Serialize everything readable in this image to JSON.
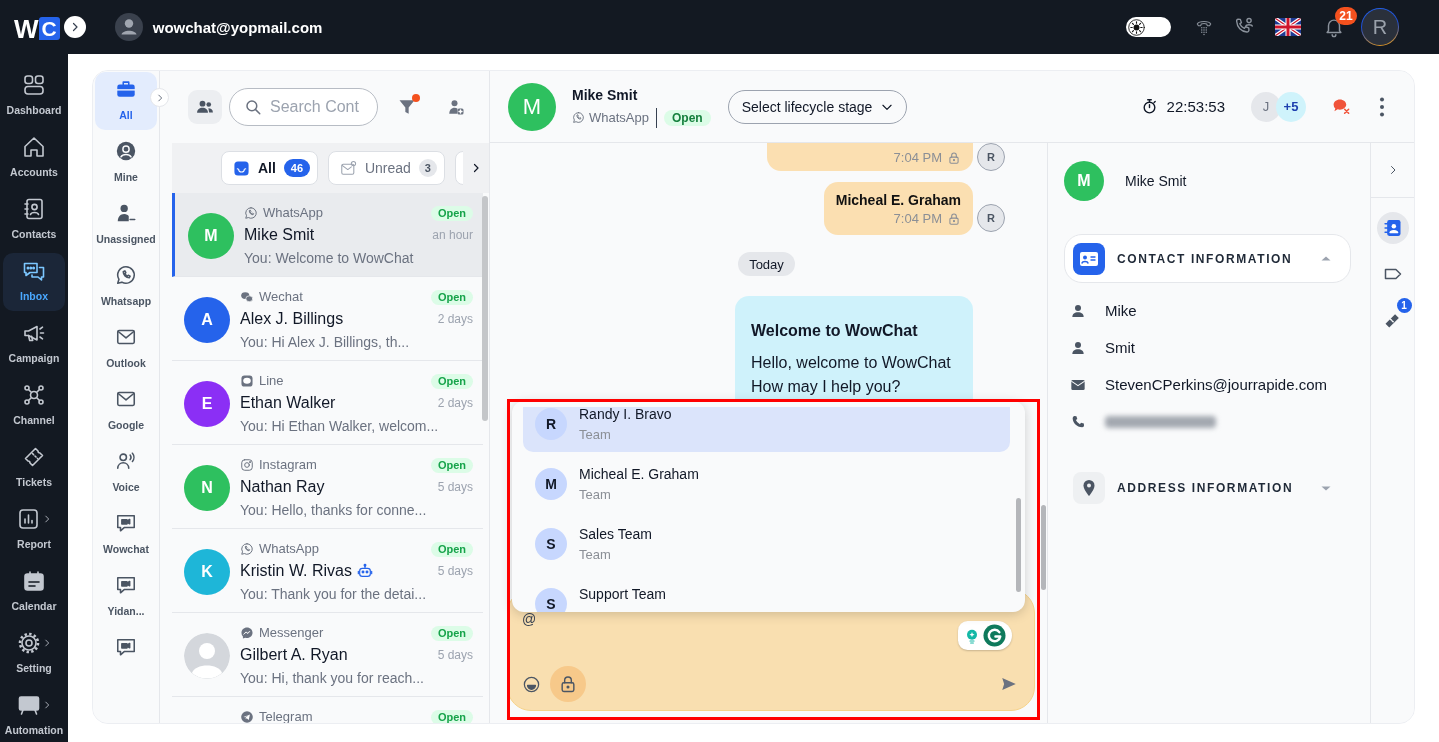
{
  "topbar": {
    "logo": {
      "first": "W",
      "second": "C"
    },
    "user_email": "wowchat@yopmail.com",
    "theme_toggle": {
      "on": false
    },
    "notification_count": "21",
    "profile_initial": "R"
  },
  "nav": {
    "items": [
      {
        "label": "Dashboard",
        "kind": "dashboard",
        "selected": false,
        "submenu": false
      },
      {
        "label": "Accounts",
        "kind": "accounts",
        "selected": false,
        "submenu": false
      },
      {
        "label": "Contacts",
        "kind": "contacts",
        "selected": false,
        "submenu": false
      },
      {
        "label": "Inbox",
        "kind": "inbox",
        "selected": true,
        "submenu": false
      },
      {
        "label": "Campaign",
        "kind": "campaign",
        "selected": false,
        "submenu": false
      },
      {
        "label": "Channel",
        "kind": "channel",
        "selected": false,
        "submenu": false
      },
      {
        "label": "Tickets",
        "kind": "tickets",
        "selected": false,
        "submenu": false
      },
      {
        "label": "Report",
        "kind": "report",
        "selected": false,
        "submenu": true
      },
      {
        "label": "Calendar",
        "kind": "calendar",
        "selected": false,
        "submenu": false
      },
      {
        "label": "Setting",
        "kind": "setting",
        "selected": false,
        "submenu": true
      },
      {
        "label": "Automation",
        "kind": "automation",
        "selected": false,
        "submenu": true
      }
    ]
  },
  "inbox_filters": {
    "items": [
      {
        "label": "All",
        "kind": "all",
        "selected": true
      },
      {
        "label": "Mine",
        "kind": "mine",
        "selected": false
      },
      {
        "label": "Unassigned",
        "kind": "unassigned",
        "selected": false
      },
      {
        "label": "Whatsapp",
        "kind": "whatsapp",
        "selected": false
      },
      {
        "label": "Outlook",
        "kind": "mail",
        "selected": false
      },
      {
        "label": "Google",
        "kind": "mail",
        "selected": false
      },
      {
        "label": "Voice",
        "kind": "voice",
        "selected": false
      },
      {
        "label": "Wowchat",
        "kind": "video",
        "selected": false
      },
      {
        "label": "Yidan...",
        "kind": "video",
        "selected": false
      },
      {
        "kind": "video",
        "selected": false
      }
    ]
  },
  "conversation_list": {
    "search": {
      "placeholder": "Search Cont"
    },
    "filter_active": true,
    "tabs": [
      {
        "label": "All",
        "count": "46",
        "kind": "all",
        "selected": true
      },
      {
        "label": "Unread",
        "count": "3",
        "kind": "unread",
        "selected": false
      }
    ],
    "conversations": [
      {
        "kind": "whatsapp",
        "channel": "WhatsApp",
        "name": "Mike Smit",
        "preview": "You: Welcome to WowChat",
        "status": "Open",
        "time": "an hour",
        "avatar": {
          "kind": "letter",
          "text": "M",
          "color": "#2ec05f"
        },
        "bot": false,
        "selected": true
      },
      {
        "kind": "wechat",
        "channel": "Wechat",
        "name": "Alex J. Billings",
        "preview": "You: Hi Alex J. Billings, th...",
        "status": "Open",
        "time": "2 days",
        "avatar": {
          "kind": "letter",
          "text": "A",
          "color": "#2563eb"
        },
        "bot": false,
        "selected": false
      },
      {
        "kind": "line",
        "channel": "Line",
        "name": "Ethan Walker",
        "preview": "You: Hi Ethan Walker, welcom...",
        "status": "Open",
        "time": "2 days",
        "avatar": {
          "kind": "letter",
          "text": "E",
          "color": "#8b2ff5"
        },
        "bot": false,
        "selected": false
      },
      {
        "kind": "instagram",
        "channel": "Instagram",
        "name": "Nathan Ray",
        "preview": "You: Hello, thanks for conne...",
        "status": "Open",
        "time": "5 days",
        "avatar": {
          "kind": "letter",
          "text": "N",
          "color": "#2ec05f"
        },
        "bot": false,
        "selected": false
      },
      {
        "kind": "whatsapp",
        "channel": "WhatsApp",
        "name": "Kristin W. Rivas",
        "preview": "You: Thank you for the detai...",
        "status": "Open",
        "time": "5 days",
        "avatar": {
          "kind": "letter",
          "text": "K",
          "color": "#1eb6d8"
        },
        "bot": true,
        "selected": false
      },
      {
        "kind": "messenger",
        "channel": "Messenger",
        "name": "Gilbert A. Ryan",
        "preview": "You: Hi, thank you for reach...",
        "status": "Open",
        "time": "5 days",
        "avatar": {
          "kind": "photo"
        },
        "bot": false,
        "selected": false
      },
      {
        "kind": "telegram",
        "channel": "Telegram",
        "status": "Open",
        "bot": false,
        "selected": false
      }
    ]
  },
  "chat": {
    "header": {
      "initial": "M",
      "name": "Mike Smit",
      "channel": {
        "kind": "whatsapp",
        "name": "WhatsApp"
      },
      "status": "Open",
      "lifecycle": {
        "placeholder": "Select lifecycle stage"
      },
      "timer": "22:53:53",
      "participants": [
        {
          "kind": "agent",
          "text": "J"
        },
        {
          "kind": "more",
          "text": "+5"
        }
      ]
    },
    "messages": [
      {
        "kind": "note",
        "time": "7:04 PM",
        "private": true,
        "author": "R"
      },
      {
        "kind": "note",
        "text": "Micheal E. Graham",
        "time": "7:04 PM",
        "private": true,
        "author": "R"
      },
      {
        "kind": "date",
        "text": "Today"
      },
      {
        "kind": "outgoing",
        "title": "Welcome to WowChat",
        "lines": [
          "Hello, welcome to WowChat",
          "How may I help you?"
        ]
      }
    ],
    "mention_menu": {
      "items": [
        {
          "initial": "R",
          "name": "Randy I. Bravo",
          "role": "Team",
          "selected": true
        },
        {
          "initial": "M",
          "name": "Micheal E. Graham",
          "role": "Team",
          "selected": false
        },
        {
          "initial": "S",
          "name": "Sales Team",
          "role": "Team",
          "selected": false
        },
        {
          "initial": "S",
          "name": "Support Team",
          "selected": false
        }
      ]
    },
    "composer": {
      "value": "@"
    },
    "highlight_frame": true
  },
  "contact_panel": {
    "initial": "M",
    "name": "Mike Smit",
    "sections": [
      {
        "kind": "contact",
        "title": "CONTACT INFORMATION",
        "expanded": true,
        "fields": [
          {
            "kind": "person",
            "value": "Mike"
          },
          {
            "kind": "person",
            "value": "Smit"
          },
          {
            "kind": "email",
            "value": "StevenCPerkins@jourrapide.com"
          },
          {
            "kind": "phone",
            "redacted": true
          }
        ]
      },
      {
        "kind": "address",
        "title": "ADDRESS INFORMATION",
        "expanded": false
      }
    ]
  },
  "side_rail": {
    "items": [
      {
        "kind": "contact",
        "selected": true
      },
      {
        "kind": "label",
        "selected": false
      },
      {
        "kind": "ticket",
        "selected": false,
        "badge": "1"
      }
    ]
  }
}
